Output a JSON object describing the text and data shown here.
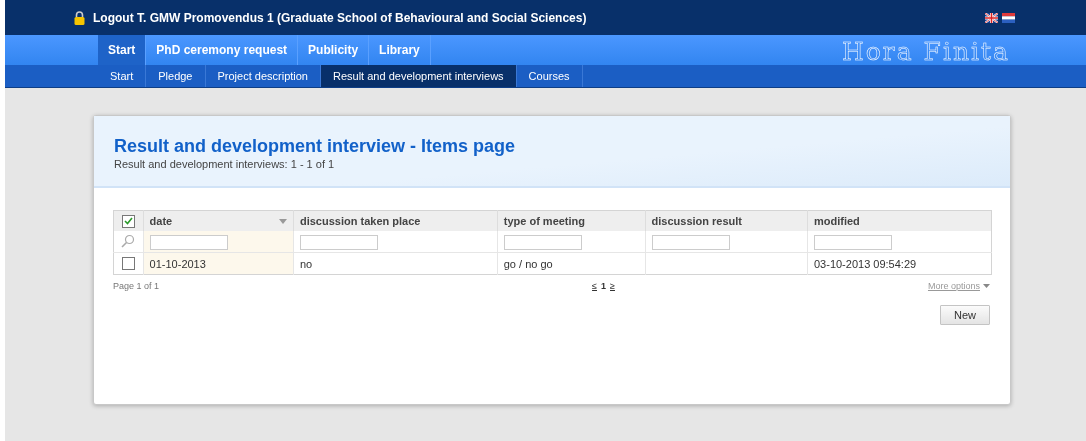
{
  "top_bar": {
    "user_text": "Logout T. GMW Promovendus 1 (Graduate School of Behavioural and Social Sciences)"
  },
  "main_nav": [
    {
      "label": "Start",
      "selected": true
    },
    {
      "label": "PhD ceremony request",
      "selected": false
    },
    {
      "label": "Publicity",
      "selected": false
    },
    {
      "label": "Library",
      "selected": false
    }
  ],
  "logo": "Hora Finita",
  "sub_nav": [
    {
      "label": "Start",
      "selected": false
    },
    {
      "label": "Pledge",
      "selected": false
    },
    {
      "label": "Project description",
      "selected": false
    },
    {
      "label": "Result and development interviews",
      "selected": true
    },
    {
      "label": "Courses",
      "selected": false
    }
  ],
  "page": {
    "title": "Result and development interview - Items page",
    "subtitle": "Result and development interviews: 1 - 1 of 1"
  },
  "table": {
    "select_all_checked": true,
    "columns": [
      {
        "label": "date",
        "sorted": true
      },
      {
        "label": "discussion taken place",
        "sorted": false
      },
      {
        "label": "type of meeting",
        "sorted": false
      },
      {
        "label": "discussion result",
        "sorted": false
      },
      {
        "label": "modified",
        "sorted": false
      }
    ],
    "rows": [
      {
        "checked": false,
        "cells": [
          "01-10-2013",
          "no",
          "go / no go",
          "",
          "03-10-2013 09:54:29"
        ]
      }
    ]
  },
  "pager": {
    "page_info": "Page 1 of 1",
    "prev": "≤",
    "current": "1",
    "next": "≥",
    "more_options": "More options"
  },
  "buttons": [
    "New"
  ]
}
